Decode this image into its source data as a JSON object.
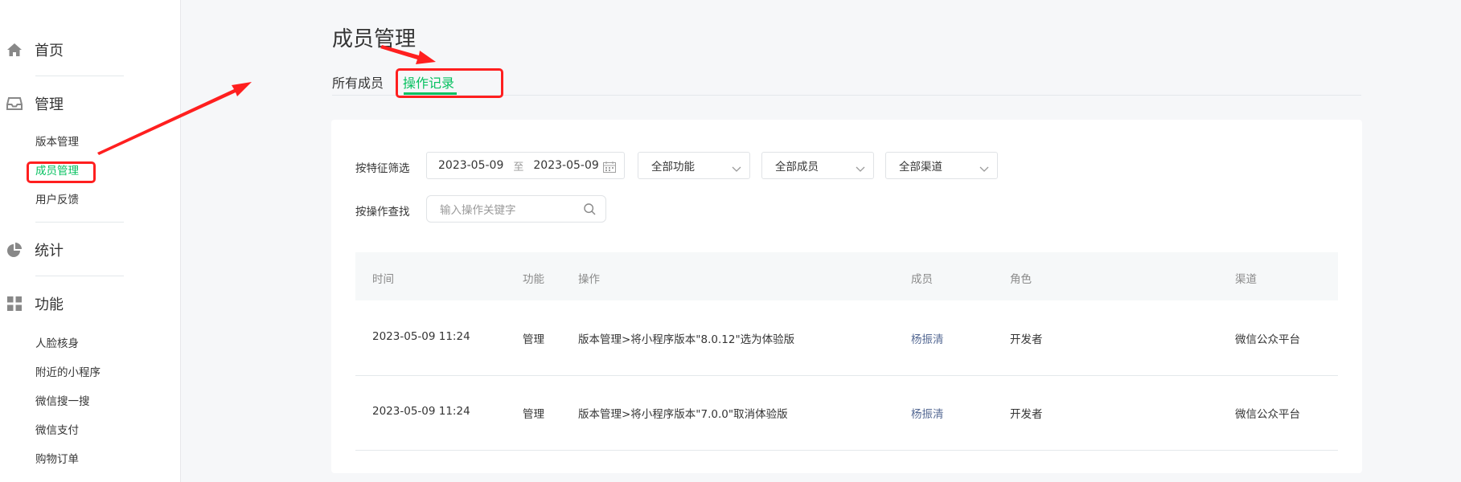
{
  "sidebar": {
    "home_label": "首页",
    "manage_label": "管理",
    "manage_items": [
      "版本管理",
      "成员管理",
      "用户反馈"
    ],
    "stats_label": "统计",
    "features_label": "功能",
    "feature_items": [
      "人脸核身",
      "附近的小程序",
      "微信搜一搜",
      "微信支付",
      "购物订单"
    ]
  },
  "page": {
    "title": "成员管理",
    "tabs": [
      "所有成员",
      "操作记录"
    ],
    "active_tab": "操作记录"
  },
  "filters": {
    "feature_filter_label": "按特征筛选",
    "date_start": "2023-05-09",
    "date_sep": "至",
    "date_end": "2023-05-09",
    "select_function": "全部功能",
    "select_member": "全部成员",
    "select_channel": "全部渠道",
    "search_label": "按操作查找",
    "search_placeholder": "输入操作关键字"
  },
  "table": {
    "columns": [
      "时间",
      "功能",
      "操作",
      "成员",
      "角色",
      "渠道"
    ],
    "rows": [
      [
        "2023-05-09 11:24",
        "管理",
        "版本管理>将小程序版本\"8.0.12\"选为体验版",
        "杨振清",
        "开发者",
        "微信公众平台"
      ],
      [
        "2023-05-09 11:24",
        "管理",
        "版本管理>将小程序版本\"7.0.0\"取消体验版",
        "杨振清",
        "开发者",
        "微信公众平台"
      ]
    ]
  },
  "colors": {
    "accent": "#07c160",
    "member_link": "#576b95",
    "highlight_box": "#ff1f1f"
  }
}
